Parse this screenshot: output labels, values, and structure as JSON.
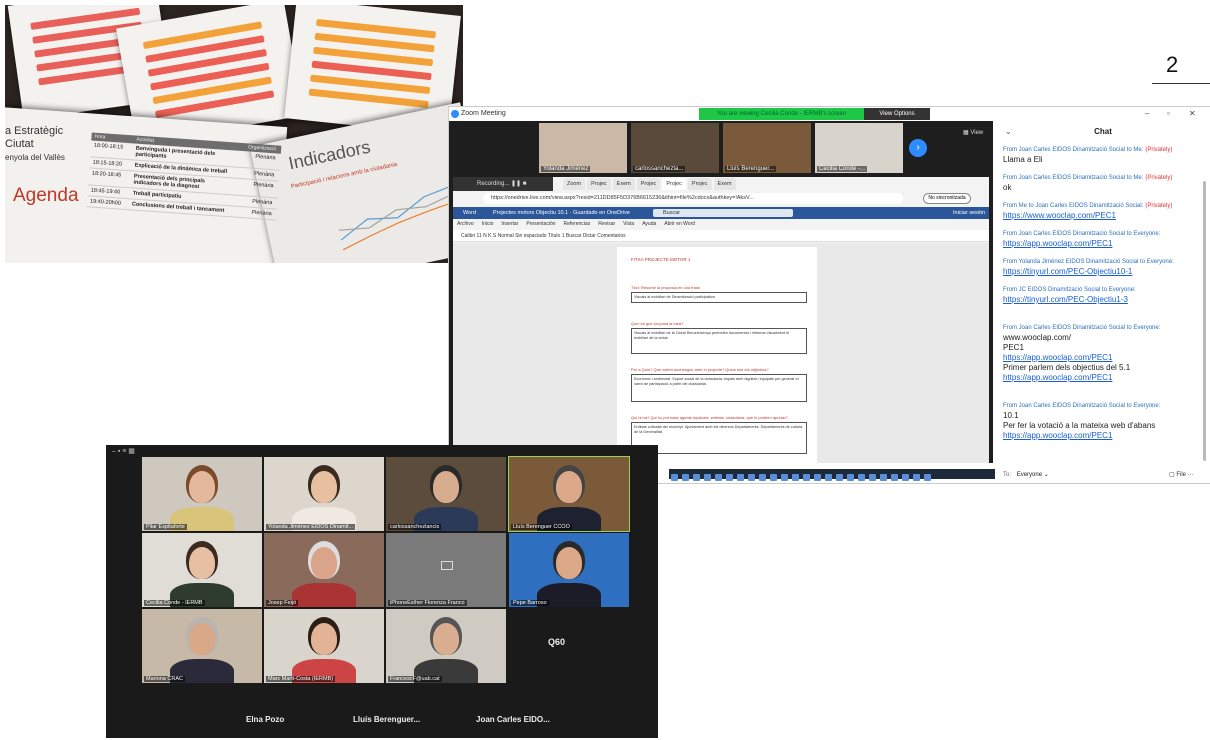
{
  "page_number": "2",
  "photo": {
    "org_title_line1": "a Estratègic",
    "org_title_line2": "Ciutat",
    "org_title_line3": "enyola del Vallès",
    "agenda_word": "Agenda",
    "agenda_headers": [
      "Hora",
      "Activitat",
      "Organització"
    ],
    "agenda_rows": [
      {
        "time": "18:00-18:15",
        "activity": "Benvinguda i presentació dels participants",
        "org": "Plenària"
      },
      {
        "time": "18:15-18:20",
        "activity": "Explicació de la dinàmica de treball",
        "org": "Plenària"
      },
      {
        "time": "18:20-18:45",
        "activity": "Presentació dels principals indicadors de la diagnosi",
        "org": "Plenària"
      },
      {
        "time": "18:45-19:40",
        "activity": "Treball participatiu",
        "org": "Plenària"
      },
      {
        "time": "19:40-20h00",
        "activity": "Conclusions del treball i tancament",
        "org": "Plenària"
      }
    ],
    "indicators_title": "Indicadors",
    "indicators_sub": "Participació i relacions amb la ciutadania"
  },
  "zoom": {
    "window_title": "Zoom Meeting",
    "viewing_banner": "You are viewing Cecilia Conde - IERMB's screen",
    "view_options": "View Options",
    "view_btn": "View",
    "thumbs": [
      {
        "name": "Yolanda Jiménez",
        "bg": "#c9b9a6"
      },
      {
        "name": "carlossanchezta...",
        "bg": "#5a4a3a"
      },
      {
        "name": "Lluís Berenguer...",
        "bg": "#7a5a3a"
      },
      {
        "name": "Cecilia Conde -...",
        "bg": "#d8d4cc"
      }
    ],
    "browser": {
      "recording": "Recording...",
      "tabs": [
        "Zoom",
        "Projec",
        "Exem",
        "Projec",
        "Projec",
        "Projec",
        "Exem"
      ],
      "address": "https://onedrive.live.com/view.aspx?resid=211DD85F5D376B6615236&ithint=file%2cdocx&authkey=!AksV...",
      "sync_btn": "No sincronitzada",
      "word_app": "Word",
      "doc_name": "Projectes motors Objectiu 10.1",
      "doc_saved": "Guardado en OneDrive",
      "search": "Buscar",
      "login": "Iniciar sesión",
      "ribbon_tabs": [
        "Archivo",
        "Inicio",
        "Insertar",
        "Presentación",
        "Referencias",
        "Revisar",
        "Vista",
        "Ayuda",
        "Abrir en Word"
      ],
      "ribbon_text": "Calibri   11   N  K  S   Normal   Sin espaciado   Título 1   Buscar   Dictar   Comentarios",
      "doc_heading": "FITXA PROJECTE MOTOR 1",
      "doc_q1": "Títol: Resumir la proposta en una frase",
      "doc_a1": "Visuals al mobiliari de Dinamització participativa",
      "doc_q2": "Quin és que proposa la idea?",
      "doc_a2": "Visuals al mobiliari de la Ciutat Reconeixença permeten documentar i informar visualment el mobiliari de la ciutat.",
      "doc_q3": "Per a Quin? Que volem aconseguir amb el projecte? Quins són els objectius?",
      "doc_a3": "Econòmic i ambiental. Suport social de la ciutadania; espais amb dignitat i equipats per generar el canvi de participació a partir del ciutadania.",
      "doc_q4": "Qui hi ha? Qui ho pot estar agents implicats, entitats, ciutadania, què hi podrien aportar?",
      "doc_a4": "Entitats culturals del municipi. Ajuntament amb els diversos Departaments. Departaments de cultura de la Generalitat."
    },
    "chat": {
      "title": "Chat",
      "messages": [
        {
          "meta": "From Joan Carles EIDOS Dinamització Social to Me:",
          "private": "(Privately)",
          "text": "Llama a Eli",
          "link": ""
        },
        {
          "meta": "From Joan Carles EIDOS Dinamització Social to Me:",
          "private": "(Privately)",
          "text": "ok",
          "link": ""
        },
        {
          "meta": "From Me to Joan Carles EIDOS Dinamització Social:",
          "private": "(Privately)",
          "text": "",
          "link": "https://www.wooclap.com/PEC1"
        },
        {
          "meta": "From Joan Carles EIDOS Dinamització Social to Everyone:",
          "private": "",
          "text": "",
          "link": "https://app.wooclap.com/PEC1"
        },
        {
          "meta": "From Yolanda Jiménez EIDOS Dinamització Social to Everyone:",
          "private": "",
          "text": "",
          "link": "https://tinyurl.com/PEC-Objectiu10-1"
        },
        {
          "meta": "From JC EIDOS Dinamització Social to Everyone:",
          "private": "",
          "text": "",
          "link": "https://tinyurl.com/PEC-Objectiu1-3"
        }
      ],
      "long_msg_meta": "From Joan Carles EIDOS Dinamització Social to Everyone:",
      "long_msg_l1": "www.wooclap.com/",
      "long_msg_l2": "PEC1",
      "long_msg_link1": "https://app.wooclap.com/PEC1",
      "long_msg_l3": "Primer parlem dels objectius del 5.1",
      "long_msg_link2": "https://app.wooclap.com/PEC1",
      "last_msg_meta": "From Joan Carles EIDOS Dinamització Social to Everyone:",
      "last_msg_l1": "10.1",
      "last_msg_l2": "Per fer la votació a la mateixa web d'abans",
      "last_msg_link": "https://app.wooclap.com/PEC1",
      "to_label": "To:",
      "to_value": "Everyone",
      "file_label": "File"
    }
  },
  "gallery": {
    "tiles": [
      {
        "name": "Pilar Espitaforte",
        "bg": "#cfc8bf",
        "skin": "#e3b89c",
        "shirt": "#d9c57a",
        "hair": "#7a4a2a"
      },
      {
        "name": "Yolanda Jiménez EIDOS Dinamit...",
        "bg": "#ddd6cc",
        "skin": "#e7c0a2",
        "shirt": "#efe9e1",
        "hair": "#3a2a1f"
      },
      {
        "name": "carlossanchezlancis",
        "bg": "#5c4c3c",
        "skin": "#d7ab8d",
        "shirt": "#2c3a5a",
        "hair": "#2a2a2a"
      },
      {
        "name": "Lluís Berenguer CCOO",
        "bg": "#7b5a3a",
        "skin": "#dba88a",
        "shirt": "#1e2230",
        "hair": "#444"
      },
      {
        "name": "Cecilia Conde - IERMB",
        "bg": "#e0ddd7",
        "skin": "#e7bfa3",
        "shirt": "#2e3b2e",
        "hair": "#3a2a1f"
      },
      {
        "name": "Josep Feijó",
        "bg": "#8a6a5a",
        "skin": "#d9a48a",
        "shirt": "#a33",
        "hair": "#ddd"
      },
      {
        "name": "iPhoneEsther Florenza Franco",
        "bg": "#7a7a7a",
        "skin": "",
        "shirt": "",
        "hair": ""
      },
      {
        "name": "Pepe Barroso",
        "bg": "#2f6fbf",
        "skin": "#dba88a",
        "shirt": "#1c1c28",
        "hair": "#2a2a2a"
      },
      {
        "name": "Mariona CRAC",
        "bg": "#c6b9a8",
        "skin": "#d8a888",
        "shirt": "#2a2a3a",
        "hair": "#b9b4ad"
      },
      {
        "name": "Marc Martí-Costa (IERMB)",
        "bg": "#d9d4cc",
        "skin": "#e2b394",
        "shirt": "#c44",
        "hair": "#2a1e16"
      },
      {
        "name": "FrancescF@uab.cat",
        "bg": "#cfcac2",
        "skin": "#d9ad90",
        "shirt": "#3a3a3a",
        "hair": "#555"
      }
    ],
    "q60": "Q60",
    "bottom_names": [
      "Elna Pozo",
      "Lluís Berenguer...",
      "Joan Carles EIDO..."
    ]
  }
}
